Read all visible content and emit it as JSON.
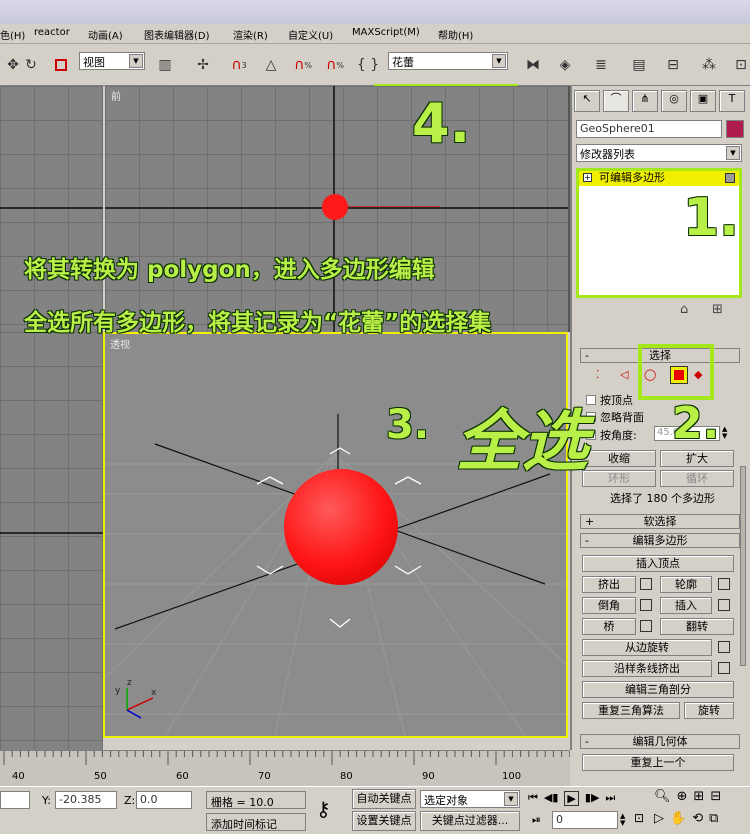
{
  "menu": [
    "色(H)",
    "reactor",
    "动画(A)",
    "图表编辑器(D)",
    "渲染(R)",
    "自定义(U)",
    "MAXScript(M)",
    "帮助(H)"
  ],
  "toolbar": {
    "view_dropdown": "视图",
    "selection_set_dropdown": "花蕾",
    "snap_labels": [
      "3",
      "%",
      "%"
    ]
  },
  "viewports": {
    "front_label": "前",
    "persp_label": "透视",
    "axis_labels": {
      "x": "x",
      "y": "y",
      "z": "z"
    }
  },
  "command_panel": {
    "object_name": "GeoSphere01",
    "object_color": "#b01c50",
    "modifier_list": "修改器列表",
    "stack_item": "可编辑多边形",
    "selection_rollout": {
      "title": "选择",
      "by_vertex": "按顶点",
      "ignore_backfacing": "忽略背面",
      "by_angle": "按角度:",
      "angle_value": "45.0",
      "shrink": "收缩",
      "grow": "扩大",
      "ring": "环形",
      "loop": "循环",
      "selected_info": "选择了 180 个多边形"
    },
    "soft_selection": "软选择",
    "edit_polygons": {
      "title": "编辑多边形",
      "insert_vertex": "插入顶点",
      "extrude": "挤出",
      "outline": "轮廓",
      "bevel": "倒角",
      "inset": "插入",
      "bridge": "桥",
      "flip": "翻转",
      "hinge_from_edge": "从边旋转",
      "extrude_along_spline": "沿样条线挤出",
      "edit_triangulation": "编辑三角剖分",
      "retriangulate": "重复三角算法",
      "turn": "旋转"
    },
    "edit_geometry": {
      "title": "编辑几何体",
      "repeat_last": "重复上一个"
    }
  },
  "annotations": {
    "step4": "4.",
    "step1": "1.",
    "step2": "2.",
    "step3": "3.",
    "quanxuan": "全选",
    "line1": "将其转换为 polygon，进入多边形编辑",
    "line2": "全选所有多边形，将其记录为“花蕾”的选择集"
  },
  "timeline": {
    "ticks": [
      "40",
      "50",
      "60",
      "70",
      "80",
      "90",
      "100"
    ]
  },
  "status": {
    "y_label": "Y:",
    "y_value": "-20.385",
    "z_label": "Z:",
    "z_value": "0.0",
    "grid": "栅格 = 10.0",
    "auto_key": "自动关键点",
    "set_key": "设置关键点",
    "selected_object": "选定对象",
    "key_filters": "关键点过滤器...",
    "add_time_tag": "添加时间标记",
    "frame_value": "0"
  },
  "colors": {
    "annotation_green": "#a4e81c",
    "sphere_red": "#ff1a1a",
    "viewport_gray": "#838383",
    "highlight_yellow": "#f0f000"
  }
}
